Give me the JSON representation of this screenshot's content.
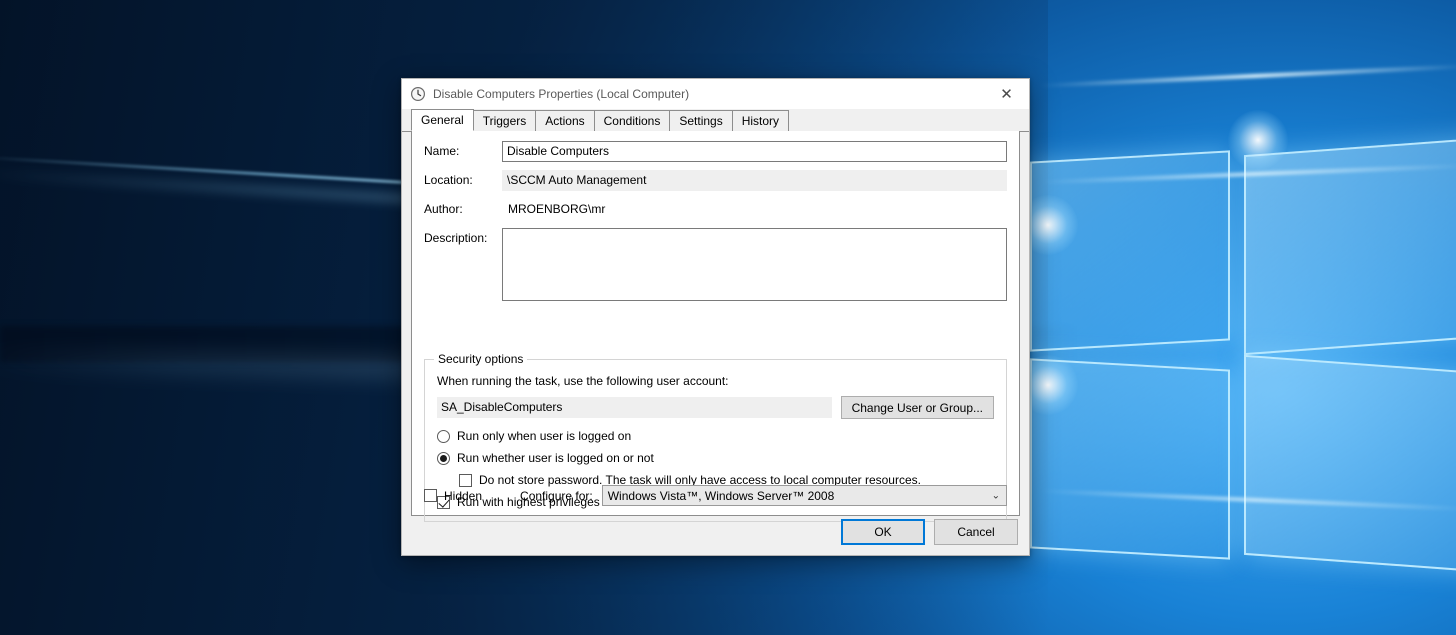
{
  "desktop": {
    "wallpaper_name": "windows-10-hero-wallpaper"
  },
  "dialog": {
    "title": "Disable Computers Properties (Local Computer)",
    "title_icon": "clock-icon",
    "close_icon": "✕",
    "tabs": [
      {
        "label": "General",
        "active": true
      },
      {
        "label": "Triggers",
        "active": false
      },
      {
        "label": "Actions",
        "active": false
      },
      {
        "label": "Conditions",
        "active": false
      },
      {
        "label": "Settings",
        "active": false
      },
      {
        "label": "History",
        "active": false
      }
    ],
    "general": {
      "name_label": "Name:",
      "name_value": "Disable Computers",
      "location_label": "Location:",
      "location_value": "\\SCCM Auto Management",
      "author_label": "Author:",
      "author_value": "MROENBORG\\mr",
      "description_label": "Description:",
      "description_value": "",
      "security": {
        "group_title": "Security options",
        "intro": "When running the task, use the following user account:",
        "account_value": "SA_DisableComputers",
        "change_user_button": "Change User or Group...",
        "radio_logged_on": "Run only when user is logged on",
        "radio_logged_on_checked": false,
        "radio_whether": "Run whether user is logged on or not",
        "radio_whether_checked": true,
        "check_no_password": "Do not store password.  The task will only have access to local computer resources.",
        "check_no_password_checked": false,
        "check_highest": "Run with highest privileges",
        "check_highest_checked": true
      },
      "hidden_label": "Hidden",
      "hidden_checked": false,
      "configure_for_label": "Configure for:",
      "configure_for_value": "Windows Vista™, Windows Server™ 2008",
      "configure_chevron": "⌄"
    },
    "footer": {
      "ok_label": "OK",
      "cancel_label": "Cancel"
    }
  },
  "colors": {
    "accent": "#0078d7",
    "dialog_bg": "#f0f0f0",
    "page_bg": "#ffffff",
    "readonly_field": "#efefef",
    "button_bg": "#e1e1e1"
  }
}
